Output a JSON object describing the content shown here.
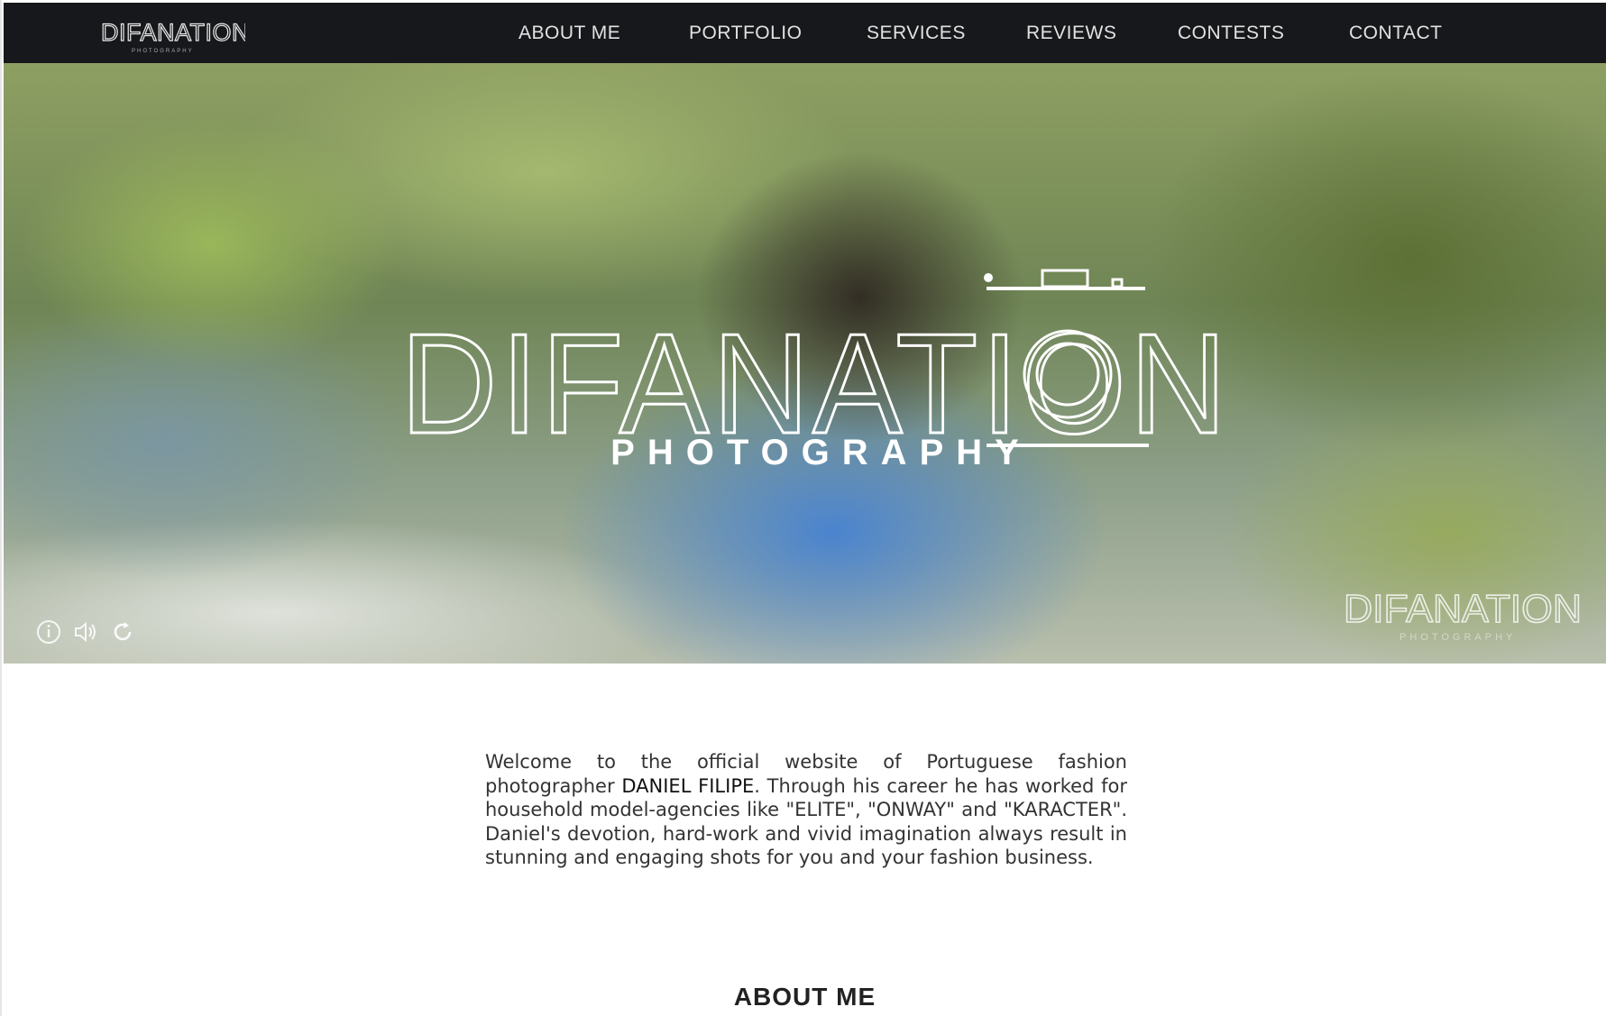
{
  "brand": {
    "logo_text": "DIFANATION",
    "logo_subtitle": "PHOTOGRAPHY"
  },
  "nav": {
    "items": [
      {
        "label": "ABOUT ME"
      },
      {
        "label": "PORTFOLIO"
      },
      {
        "label": "SERVICES"
      },
      {
        "label": "REVIEWS"
      },
      {
        "label": "CONTESTS"
      },
      {
        "label": "CONTACT"
      }
    ]
  },
  "hero": {
    "title": "DIFANATION",
    "subtitle": "PHOTOGRAPHY",
    "controls": [
      {
        "icon": "info-icon"
      },
      {
        "icon": "volume-icon"
      },
      {
        "icon": "replay-icon"
      }
    ],
    "watermark_text": "DIFANATION",
    "watermark_subtitle": "PHOTOGRAPHY"
  },
  "intro": {
    "part1": "Welcome to the official website of Portuguese fashion photographer ",
    "name": "DANIEL FILIPE",
    "part2": ". Through his career he has worked for household model-agencies like \"ELITE\", \"ONWAY\" and \"KARACTER\". Daniel's devotion, hard-work and vivid imagination always result in stunning and engaging shots for you and your fashion business."
  },
  "about": {
    "heading": "ABOUT ME"
  },
  "colors": {
    "navbar_bg": "#17181b",
    "nav_text": "#e2e2e2",
    "hero_text": "#ffffff"
  }
}
